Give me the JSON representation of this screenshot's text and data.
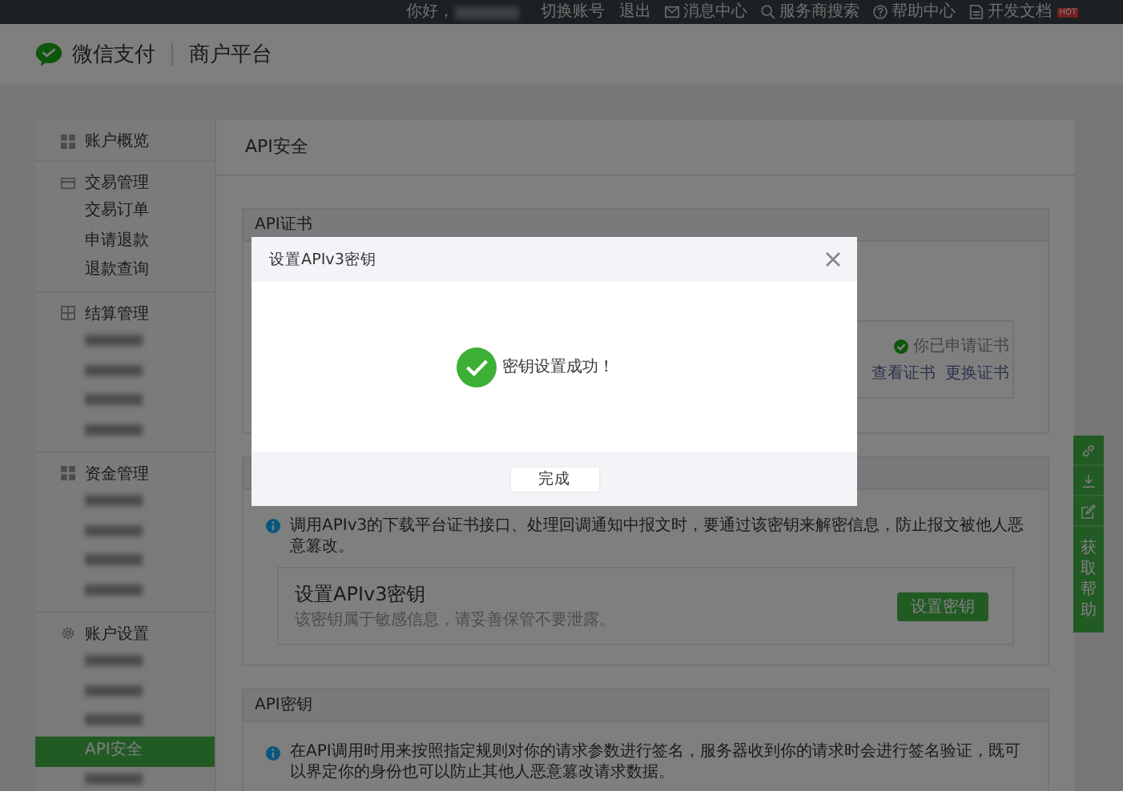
{
  "top_bar": {
    "greeting": "你好，",
    "links": [
      {
        "kind": "text",
        "label": "切换账号"
      },
      {
        "kind": "text",
        "label": "退出"
      },
      {
        "kind": "mail",
        "label": "消息中心"
      },
      {
        "kind": "search",
        "label": "服务商搜索"
      },
      {
        "kind": "help",
        "label": "帮助中心"
      },
      {
        "kind": "doc",
        "label": "开发文档",
        "badge": "HOT"
      }
    ]
  },
  "header": {
    "brand": "微信支付",
    "product": "商户平台"
  },
  "sidebar": {
    "groups": [
      {
        "title": "账户概览"
      },
      {
        "title": "交易管理",
        "items": [
          {
            "label": "交易订单",
            "selected": false
          },
          {
            "label": "申请退款",
            "selected": false
          },
          {
            "label": "退款查询",
            "selected": false
          }
        ]
      },
      {
        "title": "结算管理",
        "items": [
          {
            "redacted": true,
            "selected": false
          },
          {
            "redacted": true,
            "selected": false
          },
          {
            "redacted": true,
            "selected": false
          },
          {
            "redacted": true,
            "selected": false
          }
        ]
      },
      {
        "title": "资金管理",
        "items": [
          {
            "redacted": true,
            "selected": false
          },
          {
            "redacted": true,
            "selected": false
          },
          {
            "redacted": true,
            "selected": false
          },
          {
            "redacted": true,
            "selected": false
          }
        ]
      },
      {
        "title": "账户设置",
        "items": [
          {
            "redacted": true,
            "selected": false
          },
          {
            "redacted": true,
            "selected": false
          },
          {
            "redacted": true,
            "selected": false
          },
          {
            "label": "API安全",
            "selected": true
          },
          {
            "redacted": true,
            "selected": false
          }
        ]
      }
    ]
  },
  "main": {
    "title": "API安全",
    "cert_card": {
      "title": "API证书",
      "status": "你已申请证书",
      "links": [
        "查看证书",
        "更换证书"
      ]
    },
    "v3_card": {
      "info": "调用APIv3的下载平台证书接口、处理回调通知中报文时，要通过该密钥来解密信息，防止报文被他人恶意篡改。",
      "box_title": "设置APIv3密钥",
      "box_note": "该密钥属于敏感信息，请妥善保管不要泄露。",
      "button": "设置密钥"
    },
    "key_card": {
      "title": "API密钥",
      "info": "在API调用时用来按照指定规则对你的请求参数进行签名，服务器收到你的请求时会进行签名验证，既可以界定你的身份也可以防止其他人恶意篡改请求数据。"
    }
  },
  "help_bar": {
    "label": "获取帮助"
  },
  "dialog": {
    "title": "设置APIv3密钥",
    "message": "密钥设置成功！",
    "button": "完成"
  }
}
